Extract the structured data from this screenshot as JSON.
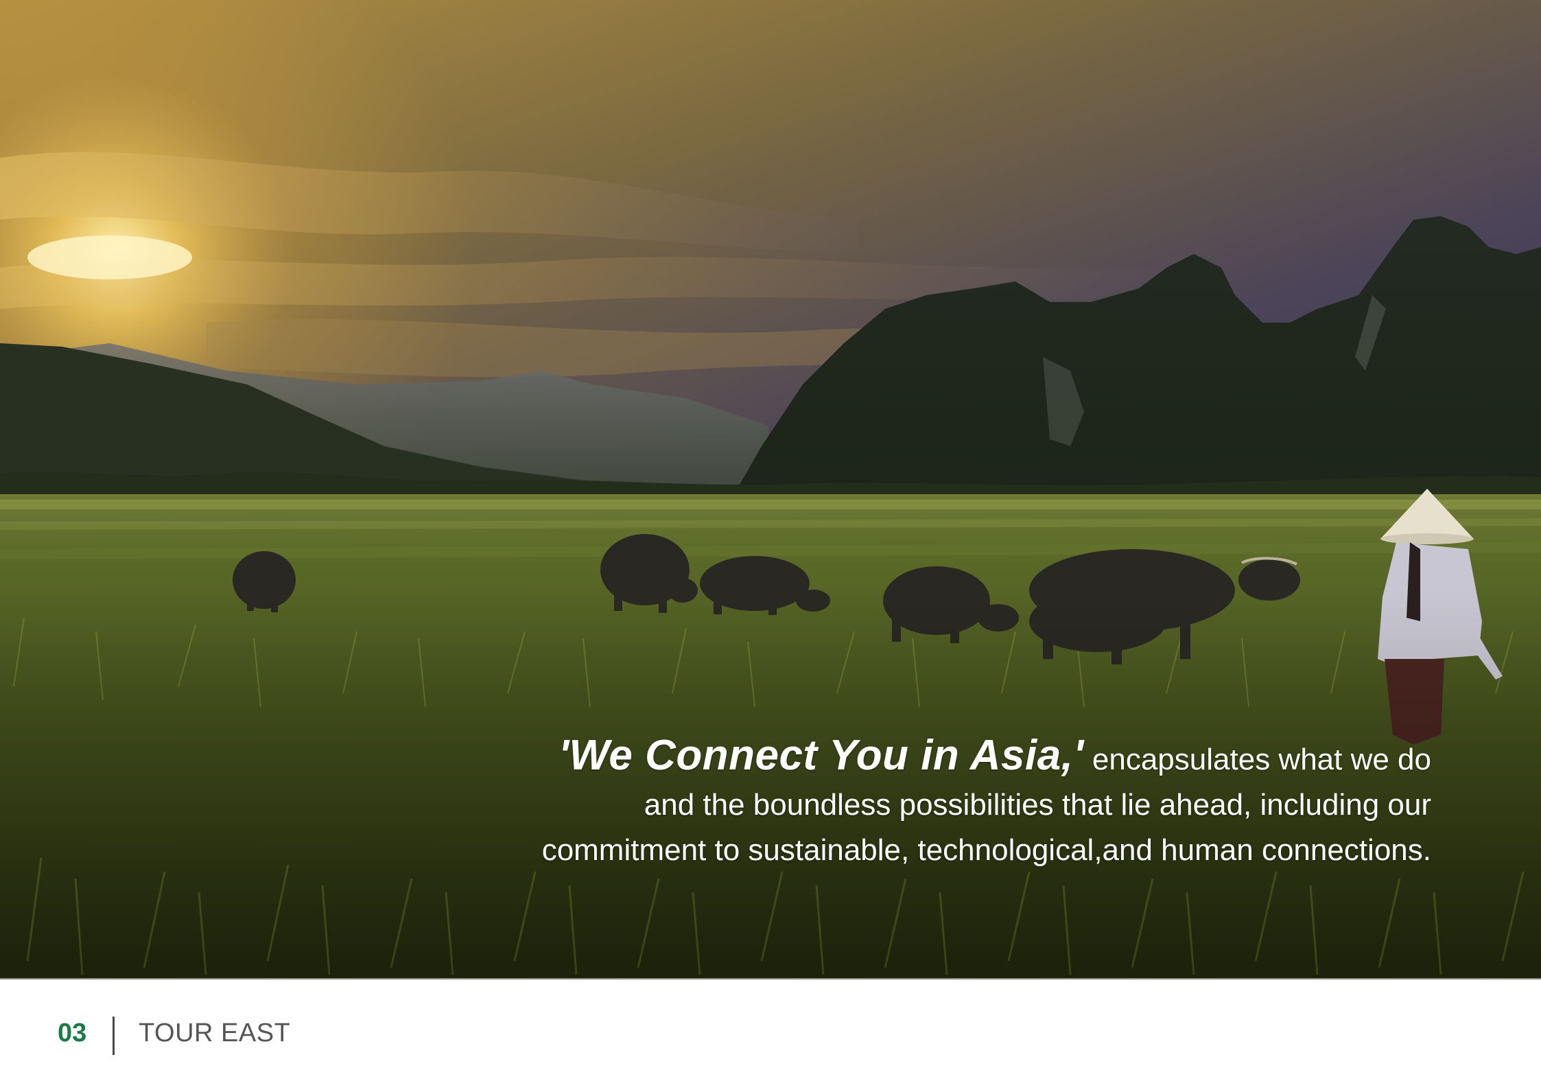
{
  "hero": {
    "image": "rice-paddy-water-buffalo-karst-sunset-photo",
    "quote_lead": "'We Connect You in Asia,'",
    "quote_lines": [
      " encapsulates what we do",
      "and the boundless possibilities that lie ahead, including our",
      "commitment to sustainable, technological,and human connections."
    ]
  },
  "footer": {
    "page_number": "03",
    "brand": "TOUR EAST"
  },
  "colors": {
    "accent": "#1d7a45",
    "text_on_photo": "#ffffff",
    "footer_text": "#555555"
  }
}
